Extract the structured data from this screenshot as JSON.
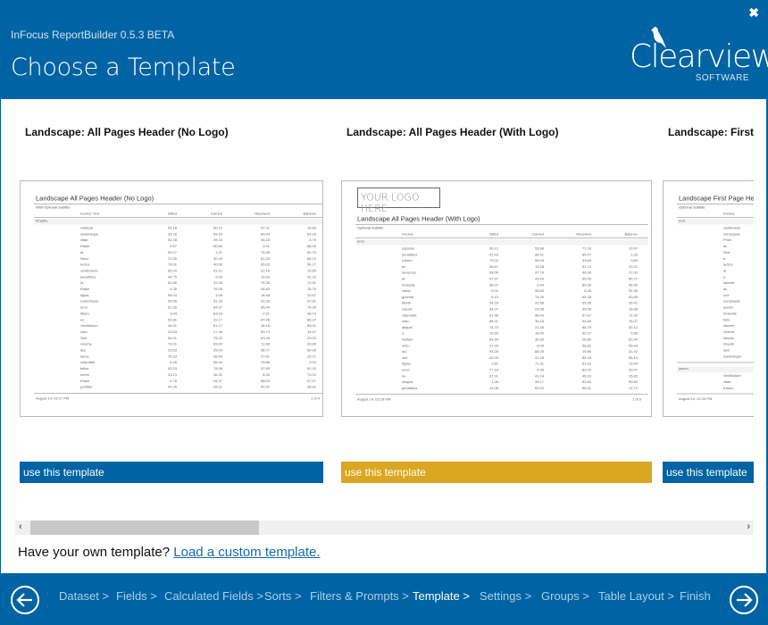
{
  "header": {
    "app_title": "InFocus ReportBuilder 0.5.3 BETA",
    "page_title": "Choose a Template",
    "logo_word": "Clearview",
    "logo_sub": "SOFTWARE",
    "close_icon": "close-icon"
  },
  "colors": {
    "brand": "#0063a3",
    "selected": "#dba620",
    "link": "#1a6aa8"
  },
  "templates": [
    {
      "label": "Landscape: All Pages Header (No Logo)",
      "button": "use this template",
      "selected": false,
      "preview": {
        "title": "Landscape All Pages Header (No Logo)",
        "subtitle": "With Optional Subtitle",
        "columns": [
          "Invoice Text",
          "Billed",
          "Earned",
          "Received",
          "Balance"
        ],
        "group": "fringilla.",
        "footer_left": "August 14, 02:17 PM",
        "footer_right": "1 of 4",
        "rows": [
          [
            "volutpat",
            "56.18",
            "50.10",
            "57.11",
            "16.83"
          ],
          [
            "scelerisque",
            "35.18",
            "69.63",
            "89.04",
            "54.18"
          ],
          [
            "vitae,",
            "92.28",
            "39.15",
            "35.18",
            "6.79"
          ],
          [
            "Etiam",
            "6.97",
            "80.89",
            "0.91",
            "68.29"
          ],
          [
            "at",
            "53.27",
            "1.37",
            "76.48",
            "86.70"
          ],
          [
            "Nunc",
            "71.39",
            "30.49",
            "61.20",
            "86.13"
          ],
          [
            "lectus",
            "79.01",
            "40.50",
            "65.03",
            "54.27"
          ],
          [
            "vestibulum,",
            "65.29",
            "91.12",
            "22.18",
            "15.85"
          ],
          [
            "penatibus",
            "44.75",
            "9.53",
            "15.53",
            "41.22"
          ],
          [
            "in,",
            "81.80",
            "22.25",
            "75.36",
            "71.91"
          ],
          [
            "Etiam",
            "4.35",
            "79.26",
            "44.82",
            "15.70"
          ],
          [
            "ligula,",
            "96.04",
            "1.08",
            "18.48",
            "20.67"
          ],
          [
            "scelerisque",
            "95.06",
            "51.24",
            "20.28",
            "97.81"
          ],
          [
            "eros.",
            "67.26",
            "84.97",
            "85.04",
            "74.26"
          ],
          [
            "libero",
            "3.44",
            "83.93",
            "2.21",
            "48.74"
          ],
          [
            "ex",
            "52.81",
            "22.17",
            "47.48",
            "86.37"
          ],
          [
            "Vestibulum",
            "46.01",
            "61.17",
            "16.18",
            "85.01"
          ],
          [
            "odio.",
            "29.34",
            "17.46",
            "83.74",
            "14.47"
          ],
          [
            "Sed",
            "54.01",
            "75.22",
            "83.09",
            "23.02"
          ],
          [
            "viverra,",
            "74.61",
            "83.04",
            "11.68",
            "93.80"
          ],
          [
            "dui.",
            "23.63",
            "25.09",
            "58.77",
            "59.95"
          ],
          [
            "lacus.",
            "76.23",
            "36.54",
            "27.81",
            "29.71"
          ],
          [
            "vulputate,",
            "8.46",
            "66.49",
            "19.86",
            "9.04"
          ],
          [
            "tellus",
            "30.23",
            "78.06",
            "37.69",
            "62.92"
          ],
          [
            "lorem",
            "33.13",
            "46.31",
            "8.45",
            "73.02"
          ],
          [
            "Etiam",
            "4.78",
            "44.57",
            "88.03",
            "47.47"
          ],
          [
            "porttitor",
            "40.26",
            "64.11",
            "40.40",
            "35.81"
          ]
        ]
      }
    },
    {
      "label": "Landscape: All Pages Header (With Logo)",
      "button": "use this template",
      "selected": true,
      "preview": {
        "logo_placeholder": "YOUR LOGO HERE",
        "title": "Landscape All Pages Header (With Logo)",
        "subtitle": "Optional Subtitle",
        "columns": [
          "Invoice",
          "Billed",
          "Earned",
          "Received",
          "Balance"
        ],
        "group": "eros.",
        "footer_left": "August 14, 02:18 PM",
        "footer_right": "1 of 5",
        "rows": [
          [
            "egestas",
            "96.12",
            "53.68",
            "71.18",
            "12.67"
          ],
          [
            "penatibus",
            "61.93",
            "98.51",
            "86.47",
            "1.33"
          ],
          [
            "rutrum",
            "79.02",
            "98.09",
            "33.66",
            "0.89"
          ],
          [
            "ac",
            "46.67",
            "13.28",
            "91.15",
            "31.01"
          ],
          [
            "senectus",
            "98.09",
            "47.74",
            "96.39",
            "27.09"
          ],
          [
            "at",
            "67.97",
            "43.53",
            "65.45",
            "86.72"
          ],
          [
            "molestie",
            "98.07",
            "9.64",
            "89.38",
            "56.45"
          ],
          [
            "natus",
            "5.01",
            "35.09",
            "8.39",
            "32.36"
          ],
          [
            "gravida",
            "5.10",
            "74.29",
            "65.18",
            "83.89"
          ],
          [
            "Morbi",
            "44.33",
            "92.58",
            "35.35",
            "36.41"
          ],
          [
            "mauris",
            "64.07",
            "24.58",
            "39.05",
            "16.88"
          ],
          [
            "vulputate,",
            "67.56",
            "98.43",
            "67.67",
            "11.26"
          ],
          [
            "odio,",
            "86.31",
            "36.18",
            "94.84",
            "15.07"
          ],
          [
            "aliquet",
            "74.70",
            "21.45",
            "88.79",
            "30.12"
          ],
          [
            "a",
            "70.34",
            "18.45",
            "92.07",
            "0.85"
          ],
          [
            "Nullam",
            "83.34",
            "30.30",
            "26.82",
            "61.04"
          ],
          [
            "odio,",
            "37.90",
            "8.09",
            "58.81",
            "95.44"
          ],
          [
            "dui.",
            "93.29",
            "68.25",
            "19.85",
            "31.92"
          ],
          [
            "orci",
            "82.04",
            "41.28",
            "85.18",
            "56.14"
          ],
          [
            "ligula,",
            "2.81",
            "71.31",
            "81.52",
            "13.04"
          ],
          [
            "nunc",
            "77.16",
            "4.90",
            "89.02",
            "30.07"
          ],
          [
            "ex",
            "37.01",
            "41.04",
            "46.19",
            "15.82"
          ],
          [
            "magna",
            "1.35",
            "39.17",
            "83.50",
            "90.60"
          ],
          [
            "penatibus",
            "43.08",
            "83.00",
            "66.41",
            "11.70"
          ]
        ]
      }
    },
    {
      "label": "Landscape: First Page Header",
      "button": "use this template",
      "selected": false,
      "preview": {
        "title": "Landscape First Page Header",
        "subtitle": "Optional Subtitle",
        "columns": [
          "Invoice"
        ],
        "group": "erat,",
        "group2": "ipsum",
        "footer_left": "August 14, 02:20 PM",
        "rows": [
          "vestibulum",
          "consequat",
          "Proin",
          "ac",
          "Sed",
          "a",
          "lectus",
          "at",
          "a",
          "laoreet",
          "ac",
          "orci",
          "consequat",
          "auctor",
          "molestie",
          "felis",
          "laoreet",
          "viverra,",
          "Mauris",
          "mauris",
          "sed,",
          "scelerisque"
        ],
        "rows2": [
          "Vestibulum",
          "vitae",
          "rutrum"
        ]
      }
    }
  ],
  "custom": {
    "prompt": "Have your own template?",
    "link": "Load a custom template."
  },
  "steps": [
    {
      "label": "Dataset >"
    },
    {
      "label": "Fields >"
    },
    {
      "label": "Calculated Fields >"
    },
    {
      "label": "Sorts >"
    },
    {
      "label": "Filters & Prompts >"
    },
    {
      "label": "Template >",
      "current": true
    },
    {
      "label": "Settings >"
    },
    {
      "label": "Groups >"
    },
    {
      "label": "Table Layout >"
    },
    {
      "label": "Finish"
    }
  ]
}
